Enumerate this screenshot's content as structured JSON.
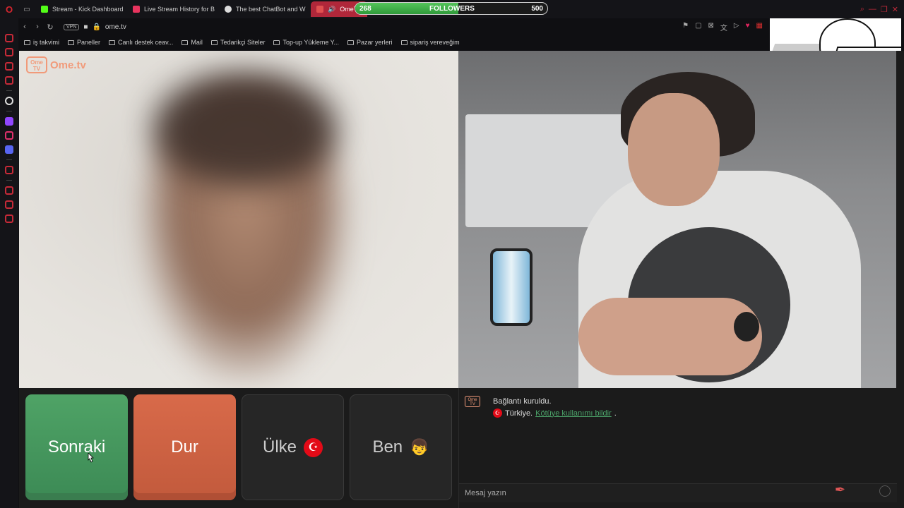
{
  "tabs": [
    {
      "label": "Stream - Kick Dashboard",
      "color": "#53fc18"
    },
    {
      "label": "Live Stream History for B",
      "color": "#e8345e"
    },
    {
      "label": "The best ChatBot and W",
      "color": "#dddddd"
    },
    {
      "label": "OmeTV",
      "color": "#e05050",
      "active": true
    }
  ],
  "followers_widget": {
    "count": "268",
    "label": "FOLLOWERS",
    "goal": "500",
    "progress": 0.536
  },
  "address": {
    "vpn": "VPN",
    "url": "ome.tv"
  },
  "bookmarks": [
    "iş takvimi",
    "Paneller",
    "Canlı destek ceav...",
    "Mail",
    "Tedarikçi Siteler",
    "Top-up Yükleme Y...",
    "Pazar yerleri",
    "sipariş vereveğim"
  ],
  "ome_logo": {
    "badge": "Ome TV",
    "text": "Ome.tv"
  },
  "buttons": {
    "next": "Sonraki",
    "stop": "Dur",
    "country": "Ülke",
    "me": "Ben"
  },
  "chat": {
    "logo": "Ome TV",
    "connected": "Bağlantı kuruldu.",
    "country": "Türkiye.",
    "report_link": "Kötüye kullanımı bildir",
    "period": ".",
    "input_placeholder": "Mesaj yazın"
  },
  "colors": {
    "accent": "#c62a38",
    "next_green": "#4fa366",
    "stop_orange": "#d86a4a",
    "link_green": "#4ca46a"
  }
}
